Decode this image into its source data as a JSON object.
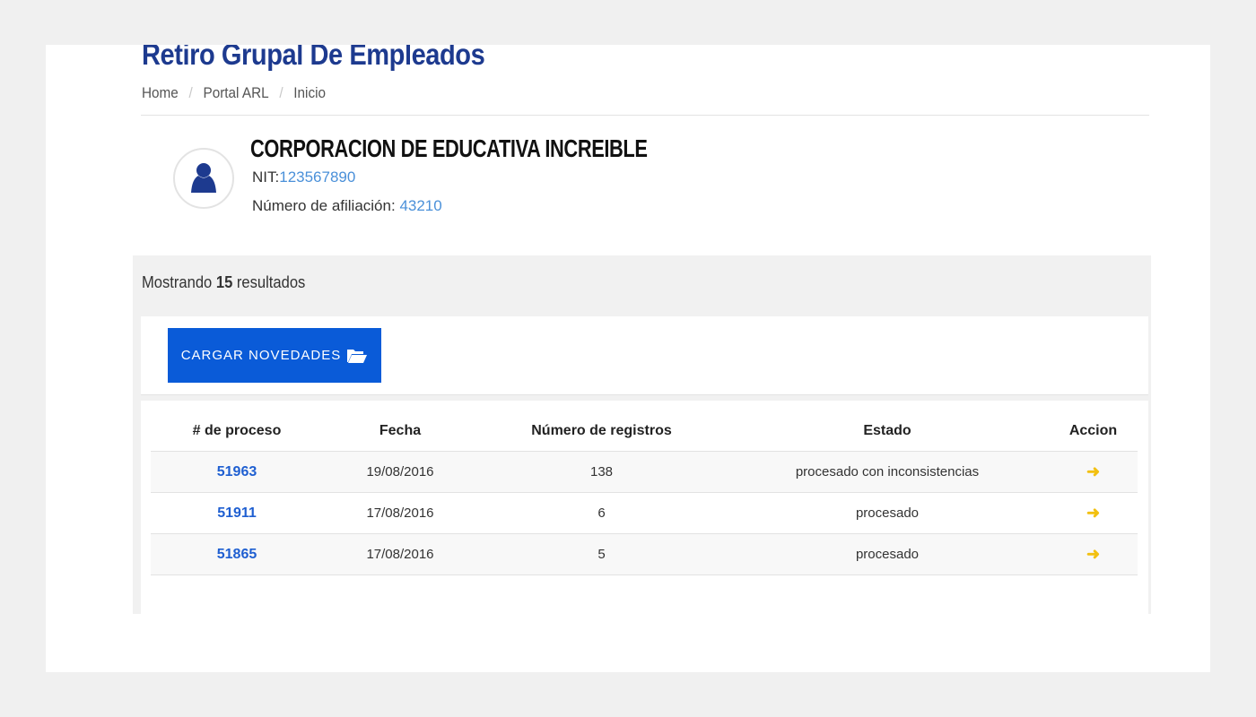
{
  "page": {
    "title": "Retiro Grupal De Empleados"
  },
  "breadcrumb": {
    "items": [
      "Home",
      "Portal ARL",
      "Inicio"
    ],
    "separator": "/"
  },
  "company": {
    "name": "CORPORACION DE EDUCATIVA INCREIBLE",
    "nit_label": "NIT:",
    "nit_value": "123567890",
    "afiliacion_label": "Número de afiliación:",
    "afiliacion_value": "43210",
    "avatar_icon": "user-silhouette-icon"
  },
  "results": {
    "prefix": "Mostrando",
    "count": "15",
    "suffix": "resultados"
  },
  "toolbar": {
    "upload_label": "CARGAR NOVEDADES",
    "upload_icon": "folder-open-icon"
  },
  "table": {
    "columns": [
      "# de proceso",
      "Fecha",
      "Número de registros",
      "Estado",
      "Accion"
    ],
    "rows": [
      {
        "proceso": "51963",
        "fecha": "19/08/2016",
        "registros": "138",
        "estado": "procesado con inconsistencias",
        "accion_icon": "arrow-right-icon"
      },
      {
        "proceso": "51911",
        "fecha": "17/08/2016",
        "registros": "6",
        "estado": "procesado",
        "accion_icon": "arrow-right-icon"
      },
      {
        "proceso": "51865",
        "fecha": "17/08/2016",
        "registros": "5",
        "estado": "procesado",
        "accion_icon": "arrow-right-icon"
      }
    ]
  },
  "colors": {
    "title": "#1d3a8f",
    "link": "#1f5fd1",
    "value": "#4a90d9",
    "button": "#0a5bd8",
    "action_arrow": "#f2c010"
  }
}
